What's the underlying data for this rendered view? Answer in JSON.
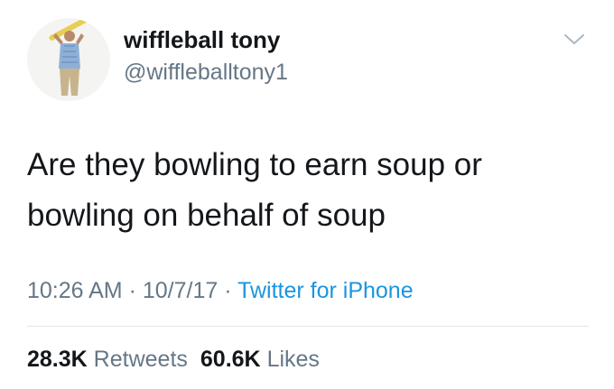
{
  "user": {
    "display_name": "wiffleball tony",
    "handle": "@wiffleballtony1",
    "avatar_icon": "profile-photo-man-holding-bat"
  },
  "tweet": {
    "lines": [
      "Are they bowling to earn soup or",
      "bowling on behalf of soup"
    ],
    "time": "10:26 AM",
    "date": "10/7/17",
    "separator": "·",
    "source": "Twitter for iPhone"
  },
  "stats": {
    "retweets_count": "28.3K",
    "retweets_label": "Retweets",
    "likes_count": "60.6K",
    "likes_label": "Likes"
  },
  "menu_icon": "chevron-down-icon",
  "colors": {
    "text": "#14171a",
    "secondary": "#657786",
    "link": "#1b95e0",
    "divider": "#e1e8ed"
  }
}
